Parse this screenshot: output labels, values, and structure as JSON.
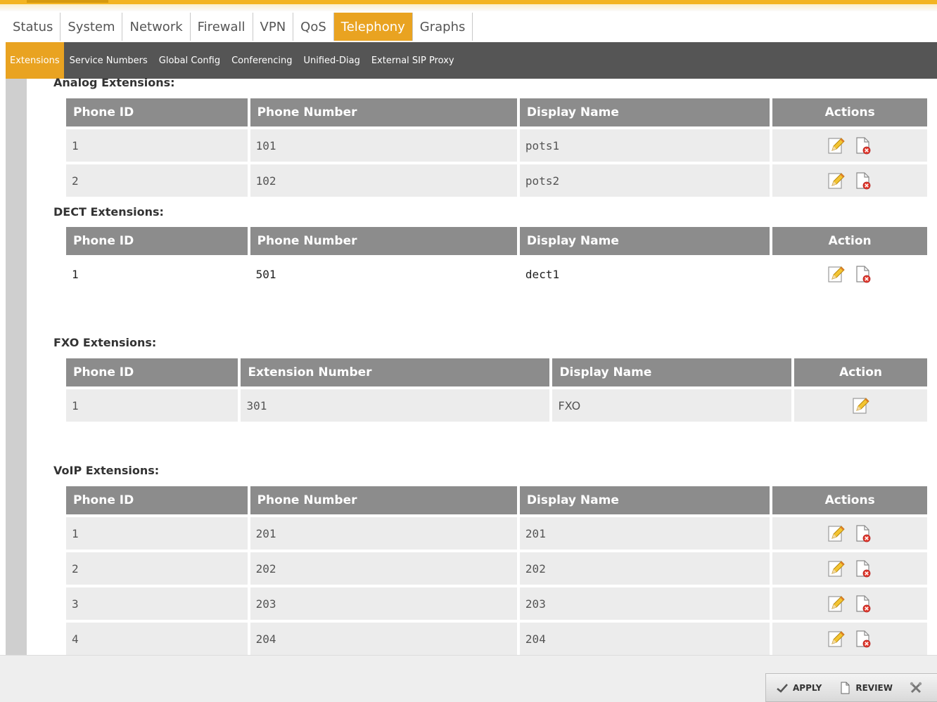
{
  "main_tabs": [
    {
      "label": "Status",
      "active": false
    },
    {
      "label": "System",
      "active": false
    },
    {
      "label": "Network",
      "active": false
    },
    {
      "label": "Firewall",
      "active": false
    },
    {
      "label": "VPN",
      "active": false
    },
    {
      "label": "QoS",
      "active": false
    },
    {
      "label": "Telephony",
      "active": true
    },
    {
      "label": "Graphs",
      "active": false
    }
  ],
  "sub_tabs": [
    {
      "label": "Extensions",
      "active": true
    },
    {
      "label": "Service Numbers",
      "active": false
    },
    {
      "label": "Global Config",
      "active": false
    },
    {
      "label": "Conferencing",
      "active": false
    },
    {
      "label": "Unified-Diag",
      "active": false
    },
    {
      "label": "External SIP Proxy",
      "active": false
    }
  ],
  "analog": {
    "title": "Analog Extensions:",
    "headers": [
      "Phone ID",
      "Phone Number",
      "Display Name",
      "Actions"
    ],
    "rows": [
      {
        "id": "1",
        "number": "101",
        "name": "pots1"
      },
      {
        "id": "2",
        "number": "102",
        "name": "pots2"
      }
    ]
  },
  "dect": {
    "title": "DECT Extensions:",
    "headers": [
      "Phone ID",
      "Phone Number",
      "Display Name",
      "Action"
    ],
    "rows": [
      {
        "id": "1",
        "number": "501",
        "name": "dect1"
      }
    ]
  },
  "fxo": {
    "title": "FXO Extensions:",
    "headers": [
      "Phone ID",
      "Extension Number",
      "Display Name",
      "Action"
    ],
    "rows": [
      {
        "id": "1",
        "number": "301",
        "name": "FXO"
      }
    ]
  },
  "voip": {
    "title": "VoIP Extensions:",
    "headers": [
      "Phone ID",
      "Phone Number",
      "Display Name",
      "Actions"
    ],
    "rows": [
      {
        "id": "1",
        "number": "201",
        "name": "201"
      },
      {
        "id": "2",
        "number": "202",
        "name": "202"
      },
      {
        "id": "3",
        "number": "203",
        "name": "203"
      },
      {
        "id": "4",
        "number": "204",
        "name": "204"
      }
    ]
  },
  "footer": {
    "apply_label": "APPLY",
    "review_label": "REVIEW"
  },
  "icons": {
    "edit": "edit-icon",
    "delete": "delete-icon",
    "apply": "checkmark-icon",
    "review": "document-icon",
    "cancel": "tools-icon"
  },
  "colors": {
    "accent": "#e9a321",
    "subnav_bg": "#555555",
    "header_bg": "#8c8c8c",
    "row_bg": "#ececec"
  }
}
